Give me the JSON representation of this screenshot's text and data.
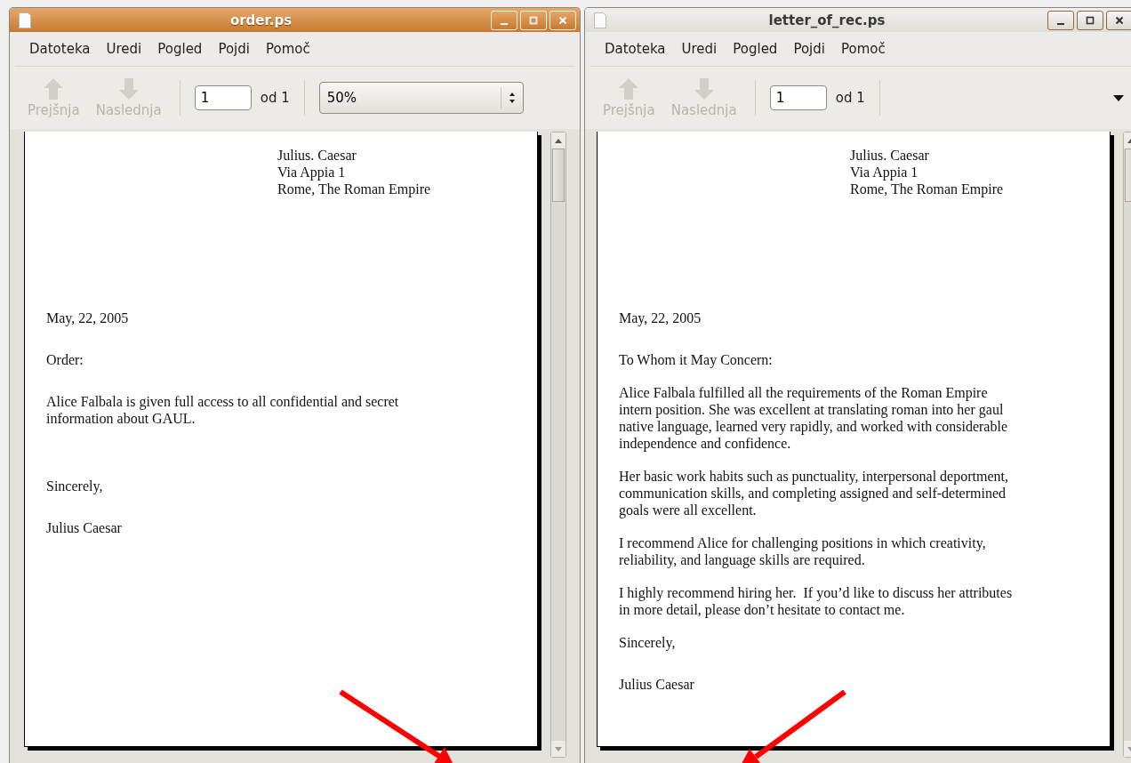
{
  "windows": [
    {
      "title": "order.ps",
      "active": true,
      "menu": [
        "Datoteka",
        "Uredi",
        "Pogled",
        "Pojdi",
        "Pomoč"
      ],
      "toolbar": {
        "prev": {
          "label": "Prejšnja",
          "disabled": true
        },
        "next": {
          "label": "Naslednja",
          "disabled": true
        },
        "page": "1",
        "page_count": "od 1",
        "zoom": "50%"
      },
      "document": {
        "header": [
          "Julius. Caesar",
          "Via Appia 1",
          "Rome, The Roman Empire"
        ],
        "blocks": [
          {
            "kind": "date",
            "lines": [
              "May, 22, 2005"
            ]
          },
          {
            "kind": "salutation",
            "lines": [
              "Order:"
            ]
          },
          {
            "kind": "body",
            "lines": [
              "Alice Falbala is given full access to all confidential and secret",
              "information about GAUL."
            ]
          },
          {
            "kind": "closing",
            "lines": [
              "Sincerely,"
            ]
          },
          {
            "kind": "signature",
            "lines": [
              "Julius Caesar"
            ]
          }
        ]
      }
    },
    {
      "title": "letter_of_rec.ps",
      "active": false,
      "menu": [
        "Datoteka",
        "Uredi",
        "Pogled",
        "Pojdi",
        "Pomoč"
      ],
      "toolbar": {
        "prev": {
          "label": "Prejšnja",
          "disabled": true
        },
        "next": {
          "label": "Naslednja",
          "disabled": true
        },
        "page": "1",
        "page_count": "od 1"
      },
      "document": {
        "header": [
          "Julius. Caesar",
          "Via Appia 1",
          "Rome, The Roman Empire"
        ],
        "blocks": [
          {
            "kind": "date",
            "lines": [
              "May, 22, 2005"
            ]
          },
          {
            "kind": "salutation",
            "lines": [
              "To Whom it May Concern:"
            ]
          },
          {
            "kind": "body",
            "lines": [
              "Alice Falbala fulfilled all the requirements of the Roman Empire",
              "intern position. She was excellent at translating roman into her gaul",
              "native language, learned very rapidly, and worked with considerable",
              "independence and confidence."
            ]
          },
          {
            "kind": "body",
            "lines": [
              "Her basic work habits such as punctuality, interpersonal deportment,",
              "communication skills, and completing assigned and self-determined",
              "goals were all excellent."
            ]
          },
          {
            "kind": "body",
            "lines": [
              "I recommend Alice for challenging positions in which creativity,",
              "reliability, and language skills are required."
            ]
          },
          {
            "kind": "body",
            "lines": [
              "I highly recommend hiring her.  If you’d like to discuss her attributes",
              "in more detail, please don’t hesitate to contact me."
            ]
          },
          {
            "kind": "closing",
            "lines": [
              "Sincerely,"
            ]
          },
          {
            "kind": "signature",
            "lines": [
              "Julius Caesar"
            ]
          }
        ]
      }
    }
  ]
}
